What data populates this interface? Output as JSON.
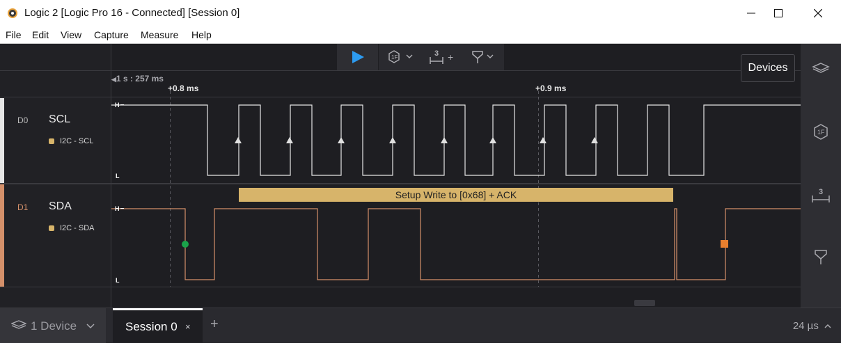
{
  "window": {
    "title": "Logic 2 [Logic Pro 16 - Connected] [Session 0]"
  },
  "menu": [
    "File",
    "Edit",
    "View",
    "Capture",
    "Measure",
    "Help"
  ],
  "timeline": {
    "origin": "1 s : 257 ms",
    "markers": [
      "+0.8 ms",
      "+0.9 ms"
    ]
  },
  "channels": [
    {
      "id": "D0",
      "name": "SCL",
      "analyzer": "I2C - SCL",
      "color": "#e6e6e6",
      "high_label": "H",
      "low_label": "L"
    },
    {
      "id": "D1",
      "name": "SDA",
      "analyzer": "I2C - SDA",
      "color": "#d4906a",
      "high_label": "H",
      "low_label": "L"
    }
  ],
  "decode": {
    "label": "Setup Write to [0x68] + ACK",
    "color": "#d7b46a"
  },
  "tooltip": "Devices",
  "bottom": {
    "device_tab": "1 Device",
    "session_tab": "Session 0",
    "close": "×",
    "add": "+",
    "zoom": "24 µs"
  },
  "icons": {
    "play": "play-icon",
    "trigger": "trigger-icon",
    "measure": "measure-icon",
    "marker": "marker-icon",
    "devices": "devices-icon"
  }
}
